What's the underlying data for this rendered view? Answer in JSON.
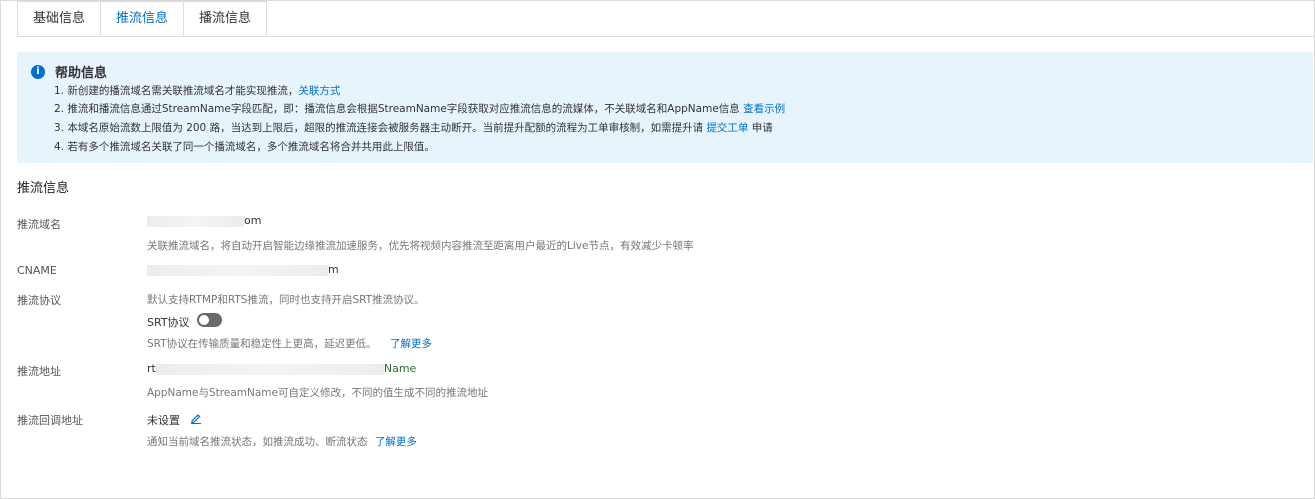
{
  "tabs": [
    {
      "label": "基础信息"
    },
    {
      "label": "推流信息"
    },
    {
      "label": "播流信息"
    }
  ],
  "help": {
    "icon": "info-icon",
    "title": "帮助信息",
    "lines": [
      {
        "text": "1. 新创建的播流域名需关联推流域名才能实现推流，",
        "link": "关联方式",
        "suffix": ""
      },
      {
        "text": "2. 推流和播流信息通过StreamName字段匹配，即：播流信息会根据StreamName字段获取对应推流信息的流媒体，不关联域名和AppName信息 ",
        "link": "查看示例",
        "suffix": ""
      },
      {
        "text": "3. 本域名原始流数上限值为 200 路，当达到上限后，超限的推流连接会被服务器主动断开。当前提升配额的流程为工单审核制，如需提升请 ",
        "link": "提交工单",
        "suffix": " 申请"
      },
      {
        "text": "4. 若有多个推流域名关联了同一个播流域名，多个推流域名将合并共用此上限值。",
        "link": "",
        "suffix": ""
      }
    ]
  },
  "section_title": "推流信息",
  "fields": {
    "domain": {
      "label": "推流域名",
      "value_prefix": "",
      "value_suffix": "om",
      "desc": "关联推流域名，将自动开启智能边缘推流加速服务，优先将视频内容推流至距离用户最近的Live节点，有效减少卡顿率"
    },
    "cname": {
      "label": "CNAME",
      "value_prefix": "",
      "value_suffix": "m"
    },
    "protocol": {
      "label": "推流协议",
      "desc": "默认支持RTMP和RTS推流，同时也支持开启SRT推流协议。",
      "srt_label": "SRT协议",
      "srt_enabled": false,
      "srt_desc": "SRT协议在传输质量和稳定性上更高，延迟更低。",
      "learn_more": "了解更多"
    },
    "address": {
      "label": "推流地址",
      "value_prefix": "rt",
      "value_suffix": "Name",
      "desc": "AppName与StreamName可自定义修改，不同的值生成不同的推流地址"
    },
    "callback": {
      "label": "推流回调地址",
      "value": "未设置",
      "desc": "通知当前域名推流状态，如推流成功、断流状态",
      "learn_more": "了解更多"
    }
  },
  "colors": {
    "accent": "#0070cc",
    "help_bg": "#e8f4fc",
    "toggle_off": "#6a6a6a"
  }
}
